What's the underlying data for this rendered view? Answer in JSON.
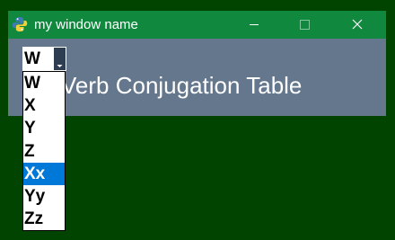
{
  "window": {
    "title": "my window name",
    "icon": "python-icon",
    "controls": {
      "minimize_icon": "minimize-icon",
      "maximize_icon": "maximize-icon",
      "close_icon": "close-icon"
    }
  },
  "content": {
    "title": "Verb Conjugation Table"
  },
  "combo": {
    "value": "W",
    "arrow_icon": "chevron-down-icon",
    "options": [
      "W",
      "X",
      "Y",
      "Z",
      "Xx",
      "Yy",
      "Zz"
    ],
    "highlighted": "Xx"
  },
  "colors": {
    "desktop": "#004400",
    "titlebar": "#10893e",
    "window_body": "#64778d",
    "highlight": "#0078d7"
  }
}
